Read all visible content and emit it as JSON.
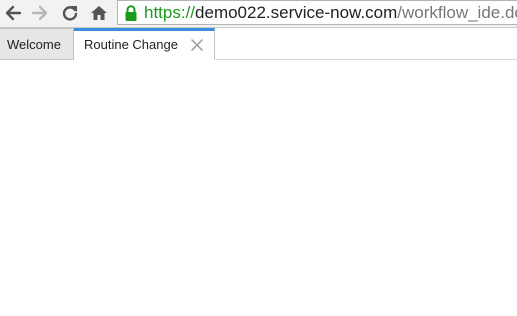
{
  "browser": {
    "url_scheme": "https://",
    "url_host": "demo022.service-now.com",
    "url_path": "/workflow_ide.do?s",
    "icons": [
      "back-icon",
      "forward-icon",
      "reload-icon",
      "home-icon",
      "lock-icon"
    ],
    "secure_color": "#1a9a1a"
  },
  "tabs": [
    {
      "label": "Welcome",
      "active": false
    },
    {
      "label": "Routine Change",
      "active": true,
      "closable": true
    }
  ],
  "colors": {
    "active_tab_accent": "#3b8ede"
  }
}
